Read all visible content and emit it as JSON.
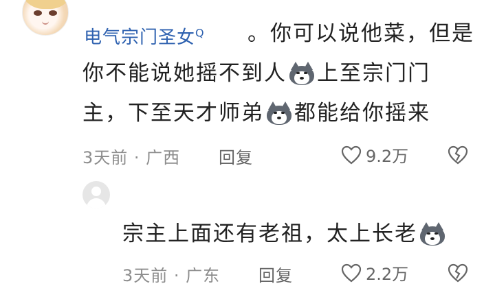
{
  "comment": {
    "username": "电气宗门圣女",
    "username_badge": "Q",
    "text_line1": "。你可以说他菜，但是",
    "text_line2_a": "你不能说她摇不到人",
    "text_line2_b": "上至宗门门",
    "text_line3_a": "主，下至天才师弟",
    "text_line3_b": "都能给你摇来",
    "time": "3天前 · 广西",
    "reply_label": "回复",
    "likes": "9.2万"
  },
  "reply": {
    "text_a": "宗主上面还有老祖，太上长老",
    "time": "3天前 · 广东",
    "reply_label": "回复",
    "likes": "2.2万"
  },
  "icons": {
    "emoji": "husky-emoji",
    "like": "heart-icon",
    "dislike": "broken-heart-icon"
  }
}
